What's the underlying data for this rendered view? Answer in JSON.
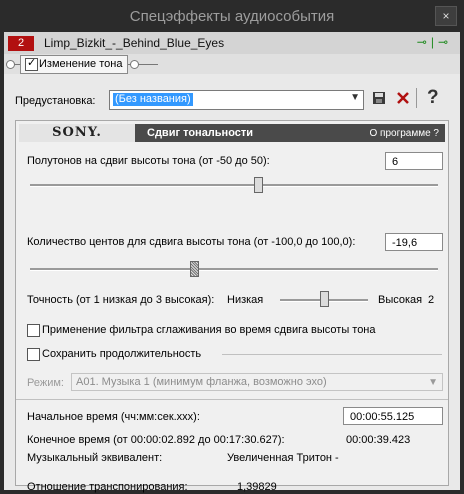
{
  "window": {
    "title": "Спецэффекты аудиособытия",
    "close_label": "×"
  },
  "chain": {
    "number": "2",
    "name": "Limp_Bizkit_-_Behind_Blue_Eyes",
    "icons": [
      "plug-in-chain-icon",
      "plug-in-icon"
    ]
  },
  "plugin_tab": {
    "label": "Изменение тона",
    "checked": true
  },
  "preset": {
    "label": "Предустановка:",
    "value": "(Без названия)",
    "save_icon": "save-icon",
    "delete_icon": "delete-icon",
    "help_icon": "help-icon"
  },
  "plugin": {
    "brand": "SONY.",
    "name": "Сдвиг тональности",
    "about": "О программе ?"
  },
  "semitones": {
    "label": "Полутонов на сдвиг высоты тона (от -50 до 50):",
    "value": "6",
    "min": -50,
    "max": 50
  },
  "cents": {
    "label": "Количество центов для сдвига высоты тона (от -100,0 до 100,0):",
    "value": "-19,6",
    "min": -100,
    "max": 100
  },
  "accuracy": {
    "label": "Точность (от 1 низкая до 3 высокая):",
    "low_label": "Низкая",
    "high_label": "Высокая",
    "value": "2",
    "min": 1,
    "max": 3
  },
  "antialias": {
    "label": "Применение фильтра сглаживания во время сдвига высоты тона",
    "checked": false
  },
  "preserve_duration": {
    "label": "Сохранить продолжительность",
    "checked": false
  },
  "mode": {
    "label": "Режим:",
    "value": "A01. Музыка 1 (минимум фланжа, возможно эхо)"
  },
  "timing": {
    "start_label": "Начальное время (чч:мм:сек.ххх):",
    "start_value": "00:00:55.125",
    "end_label": "Конечное время (от 00:00:02.892 до 00:17:30.627):",
    "end_value": "00:00:39.423",
    "musical_label": "Музыкальный эквивалент:",
    "musical_value": "Увеличенная Тритон -",
    "ratio_label": "Отношение транспонирования:",
    "ratio_value": "1,39829"
  }
}
